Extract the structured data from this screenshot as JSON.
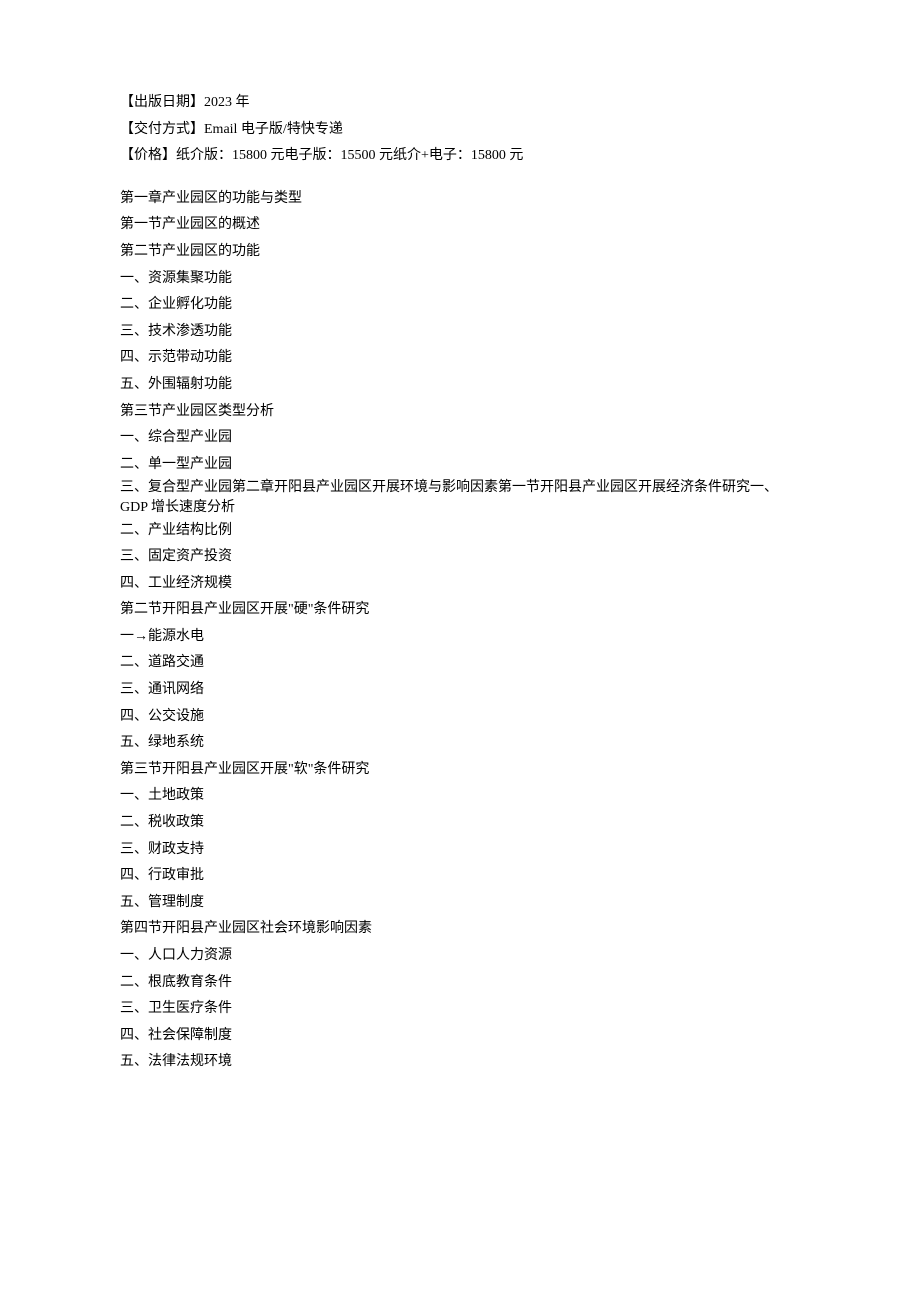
{
  "meta": {
    "pub_date": "【出版日期】2023 年",
    "delivery": "【交付方式】Email 电子版/特快专递",
    "price": "【价格】纸介版：15800 元电子版：15500 元纸介+电子：15800 元"
  },
  "lines": [
    "第一章产业园区的功能与类型",
    "第一节产业园区的概述",
    "第二节产业园区的功能",
    "一、资源集聚功能",
    "二、企业孵化功能",
    "三、技术渗透功能",
    "四、示范带动功能",
    "五、外围辐射功能",
    "第三节产业园区类型分析",
    "一、综合型产业园",
    "二、单一型产业园",
    "三、复合型产业园第二章开阳县产业园区开展环境与影响因素第一节开阳县产业园区开展经济条件研究一、GDP 增长速度分析",
    "二、产业结构比例",
    "三、固定资产投资",
    "四、工业经济规模",
    "第二节开阳县产业园区开展\"硬\"条件研究",
    "一→能源水电",
    "二、道路交通",
    "三、通讯网络",
    "四、公交设施",
    "五、绿地系统",
    "第三节开阳县产业园区开展\"软\"条件研究",
    "一、土地政策",
    "二、税收政策",
    "三、财政支持",
    "四、行政审批",
    "五、管理制度",
    "第四节开阳县产业园区社会环境影响因素",
    "一、人口人力资源",
    "二、根底教育条件",
    "三、卫生医疗条件",
    "四、社会保障制度",
    "五、法律法规环境"
  ]
}
